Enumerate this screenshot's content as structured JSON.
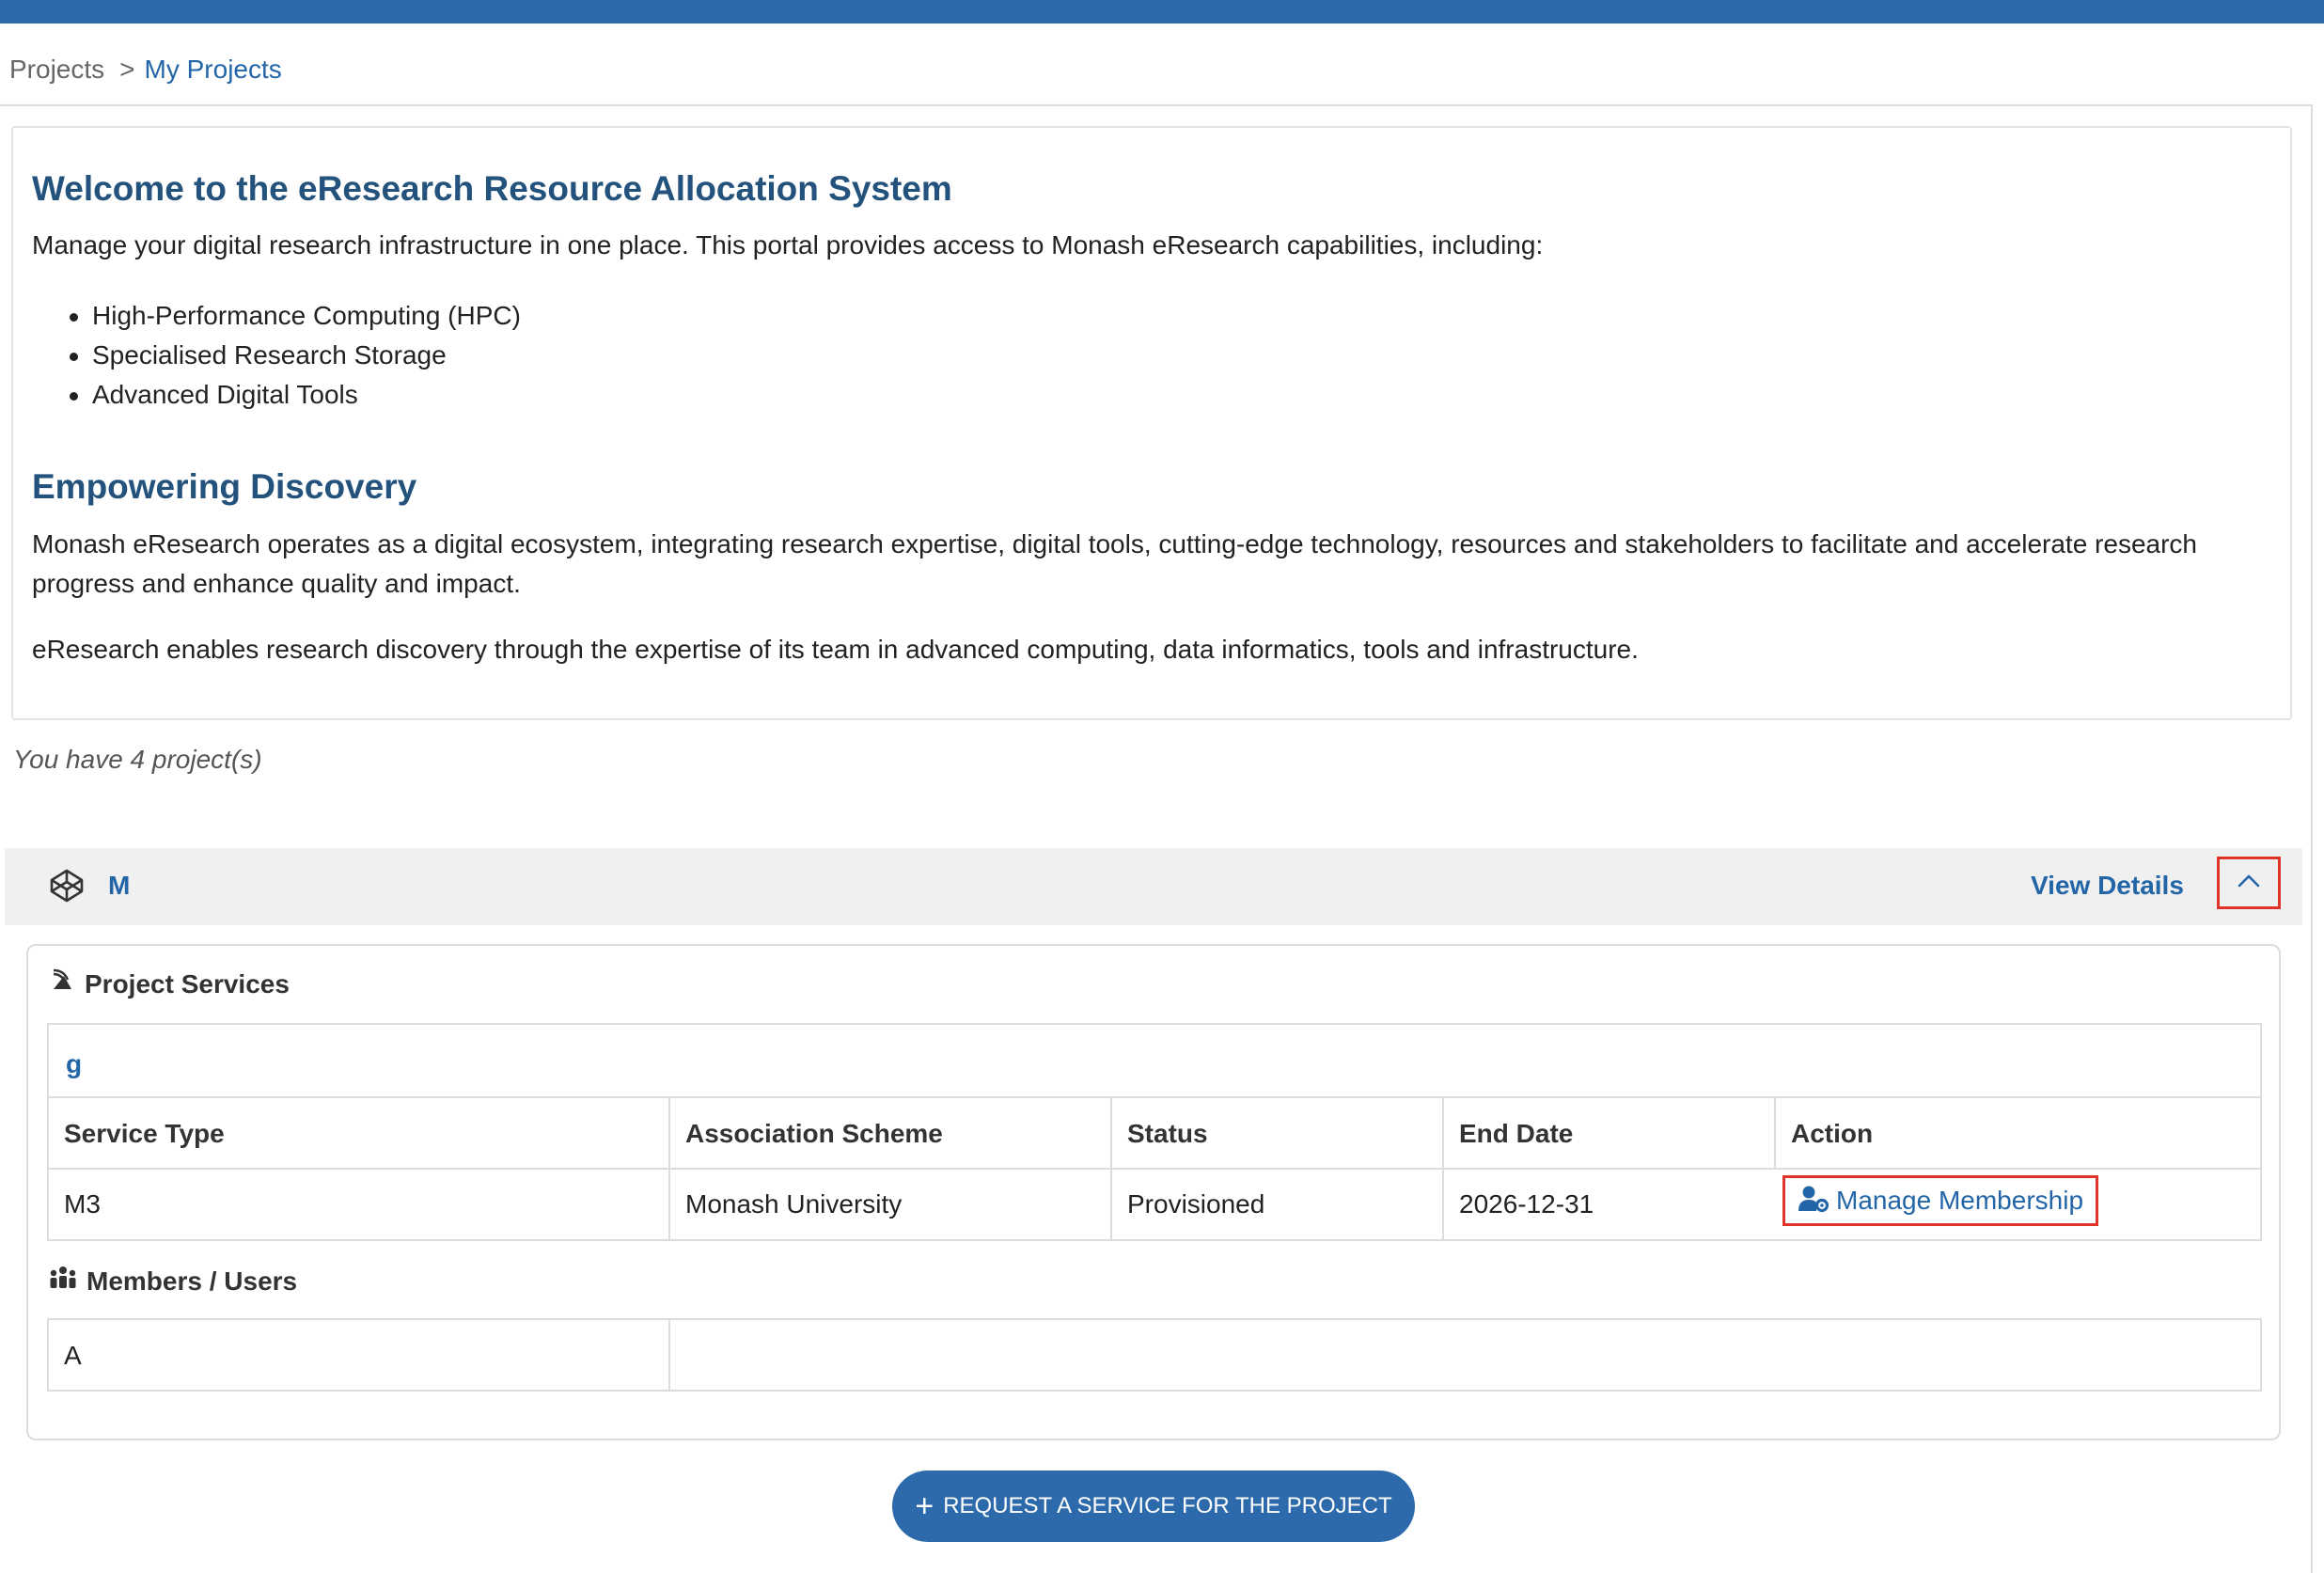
{
  "breadcrumb": {
    "root": "Projects",
    "separator": ">",
    "current": "My Projects"
  },
  "welcome": {
    "title": "Welcome to the eResearch Resource Allocation System",
    "intro": "Manage your digital research infrastructure in one place. This portal provides access to Monash eResearch capabilities, including:",
    "capabilities": [
      "High-Performance Computing (HPC)",
      "Specialised Research Storage",
      "Advanced Digital Tools"
    ]
  },
  "discovery": {
    "title": "Empowering Discovery",
    "paragraph1": "Monash eResearch operates as a digital ecosystem, integrating research expertise, digital tools, cutting-edge technology, resources and stakeholders to facilitate and accelerate research progress and enhance quality and impact.",
    "paragraph2": "eResearch enables research discovery through the expertise of its team in advanced computing, data informatics, tools and infrastructure."
  },
  "project_count_text": "You have 4 project(s)",
  "project": {
    "name": "M",
    "view_details_label": "View Details",
    "icons": {
      "project": "codepen-icon",
      "collapse": "chevron-up-icon"
    }
  },
  "services": {
    "section_title": "Project Services",
    "group_label": "g",
    "columns": [
      "Service Type",
      "Association Scheme",
      "Status",
      "End Date",
      "Action"
    ],
    "rows": [
      {
        "service_type": "M3",
        "association_scheme": "Monash University",
        "status": "Provisioned",
        "end_date": "2026-12-31",
        "action_label": "Manage Membership"
      }
    ]
  },
  "members": {
    "section_title": "Members / Users",
    "rows": [
      {
        "name": "A"
      }
    ]
  },
  "request_button_label": "REQUEST A SERVICE FOR THE PROJECT",
  "colors": {
    "topbar": "#2d6aab",
    "link": "#2366a8",
    "heading": "#23527c",
    "highlight": "#e0342a"
  }
}
